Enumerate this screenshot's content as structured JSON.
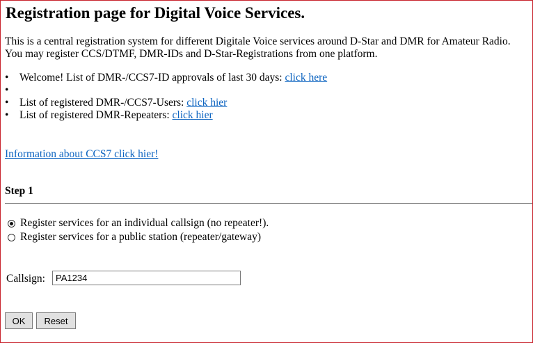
{
  "page": {
    "title": "Registration page for Digital Voice Services.",
    "intro_line1": "This is a central registration system for different Digitale Voice services around D-Star and DMR for Amateur Radio.",
    "intro_line2": "You may register CCS/DTMF, DMR-IDs and D-Star-Registrations from one platform."
  },
  "links": {
    "bullet": "•",
    "items": [
      {
        "text": "Welcome! List of DMR-/CCS7-ID approvals of last 30 days: ",
        "link": "click here"
      },
      {
        "text": "",
        "link": ""
      },
      {
        "text": "List of registered DMR-/CCS7-Users: ",
        "link": "click hier"
      },
      {
        "text": "List of registered DMR-Repeaters: ",
        "link": "click hier"
      }
    ],
    "info_link": "Information about CCS7 click hier!"
  },
  "form": {
    "step_label": "Step 1",
    "options": [
      {
        "label": "Register services for an individual callsign (no repeater!).",
        "checked": true
      },
      {
        "label": "Register services for a public station (repeater/gateway)",
        "checked": false
      }
    ],
    "callsign_label": "Callsign:",
    "callsign_value": "PA1234",
    "ok_label": "OK",
    "reset_label": "Reset"
  }
}
